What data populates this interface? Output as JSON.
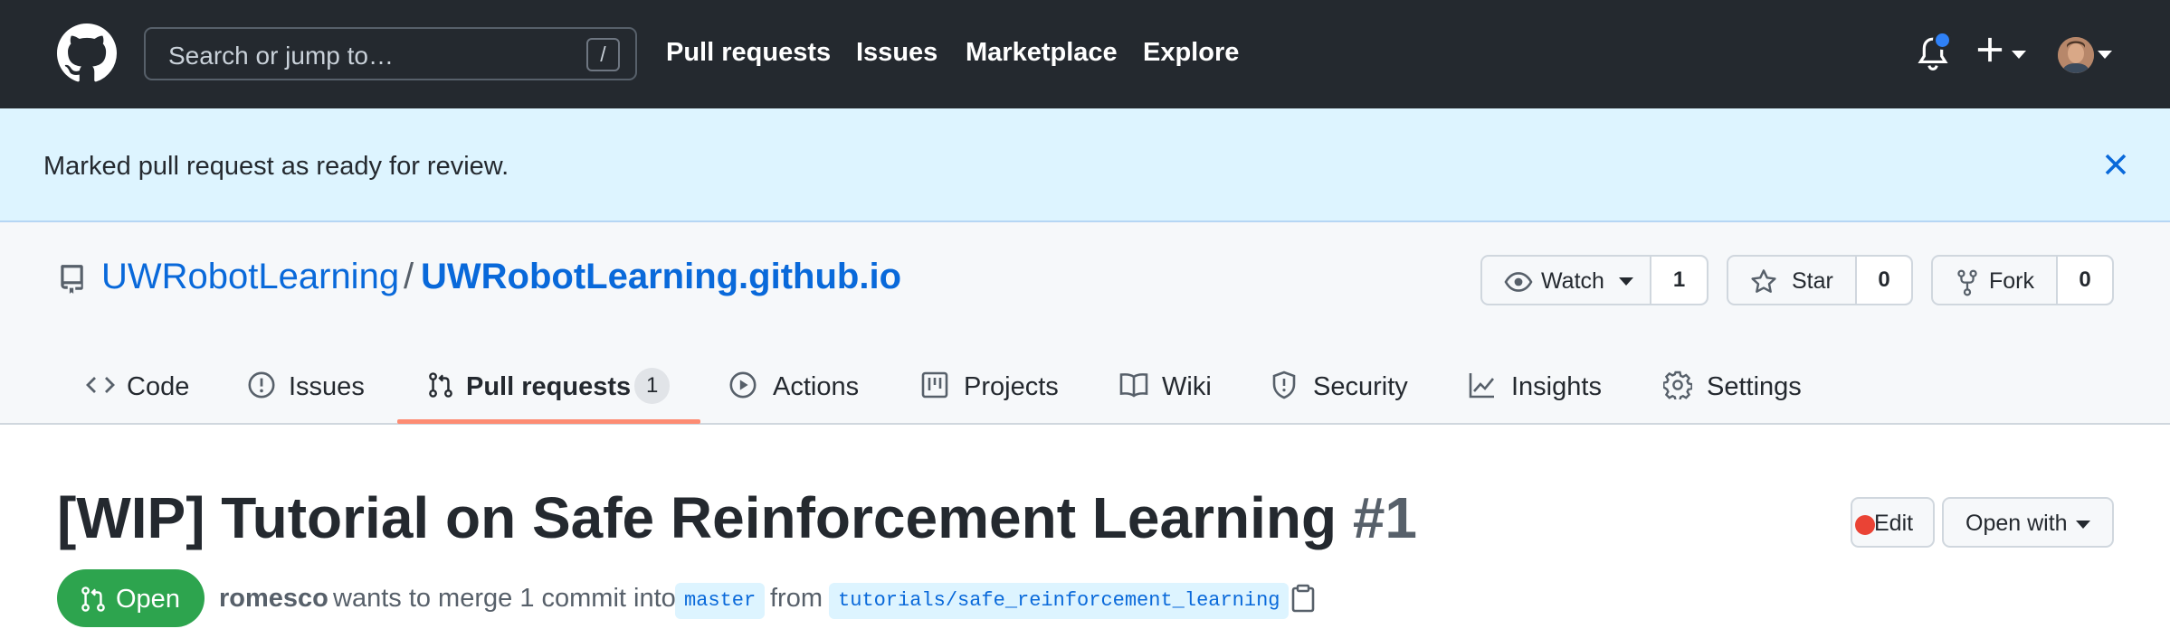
{
  "header": {
    "search_placeholder": "Search or jump to…",
    "search_shortcut": "/",
    "nav": [
      "Pull requests",
      "Issues",
      "Marketplace",
      "Explore"
    ],
    "icons": [
      "github-logo-icon",
      "bell-icon",
      "plus-icon",
      "avatar"
    ]
  },
  "flash": {
    "message": "Marked pull request as ready for review."
  },
  "repo": {
    "owner": "UWRobotLearning",
    "separator": "/",
    "name": "UWRobotLearning.github.io",
    "watch": {
      "label": "Watch",
      "count": "1"
    },
    "star": {
      "label": "Star",
      "count": "0"
    },
    "fork": {
      "label": "Fork",
      "count": "0"
    }
  },
  "tabs": [
    {
      "label": "Code",
      "icon": "code-icon"
    },
    {
      "label": "Issues",
      "icon": "issue-icon"
    },
    {
      "label": "Pull requests",
      "icon": "pull-request-icon",
      "count": "1",
      "active": true
    },
    {
      "label": "Actions",
      "icon": "play-icon"
    },
    {
      "label": "Projects",
      "icon": "project-icon"
    },
    {
      "label": "Wiki",
      "icon": "book-icon"
    },
    {
      "label": "Security",
      "icon": "shield-icon"
    },
    {
      "label": "Insights",
      "icon": "graph-icon"
    },
    {
      "label": "Settings",
      "icon": "gear-icon"
    }
  ],
  "pr": {
    "title": "[WIP] Tutorial on Safe Reinforcement Learning",
    "number": "#1",
    "edit_label": "Edit",
    "open_with_label": "Open with",
    "state": "Open",
    "author": "romesco",
    "merge_text": "wants to merge 1 commit into",
    "base_branch": "master",
    "from_text": "from",
    "head_branch": "tutorials/safe_reinforcement_learning"
  },
  "colors": {
    "header_bg": "#24292f",
    "flash_bg": "#ddf4ff",
    "link": "#0969da",
    "open_green": "#2da44e",
    "tab_underline": "#fd8c73"
  }
}
